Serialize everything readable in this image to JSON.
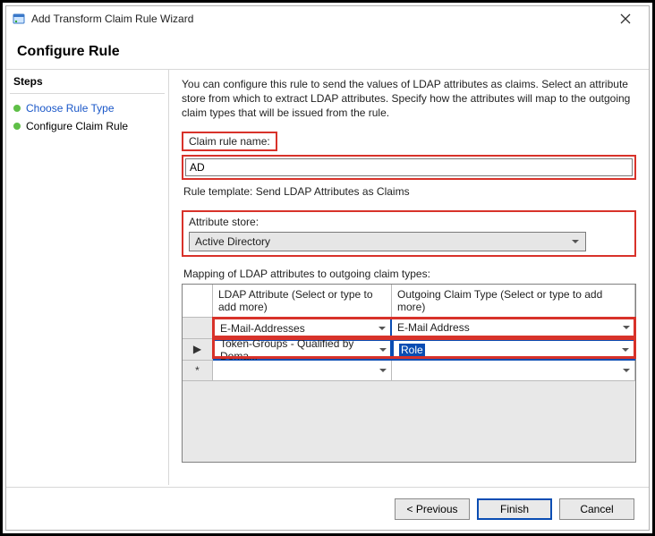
{
  "titlebar": {
    "title": "Add Transform Claim Rule Wizard",
    "close": "Close"
  },
  "header": "Configure Rule",
  "steps": {
    "title": "Steps",
    "items": [
      {
        "label": "Choose Rule Type",
        "link": true
      },
      {
        "label": "Configure Claim Rule",
        "link": false
      }
    ]
  },
  "main": {
    "description": "You can configure this rule to send the values of LDAP attributes as claims. Select an attribute store from which to extract LDAP attributes. Specify how the attributes will map to the outgoing claim types that will be issued from the rule.",
    "claim_rule_name_label": "Claim rule name:",
    "claim_rule_name_value": "AD",
    "rule_template": "Rule template: Send LDAP Attributes as Claims",
    "attribute_store_label": "Attribute store:",
    "attribute_store_value": "Active Directory",
    "mapping_label": "Mapping of LDAP attributes to outgoing claim types:",
    "grid": {
      "col1": "LDAP Attribute (Select or type to add more)",
      "col2": "Outgoing Claim Type (Select or type to add more)",
      "rows": [
        {
          "ldap": "E-Mail-Addresses",
          "claim": "E-Mail Address",
          "marker": ""
        },
        {
          "ldap": "Token-Groups - Qualified by Doma...",
          "claim": "Role",
          "marker": "▶"
        },
        {
          "ldap": "",
          "claim": "",
          "marker": "*"
        }
      ]
    }
  },
  "buttons": {
    "previous": "< Previous",
    "finish": "Finish",
    "cancel": "Cancel"
  },
  "icons": {
    "wizard": "wizard-icon",
    "close": "close-icon",
    "chevron_down": "chevron-down-icon"
  }
}
